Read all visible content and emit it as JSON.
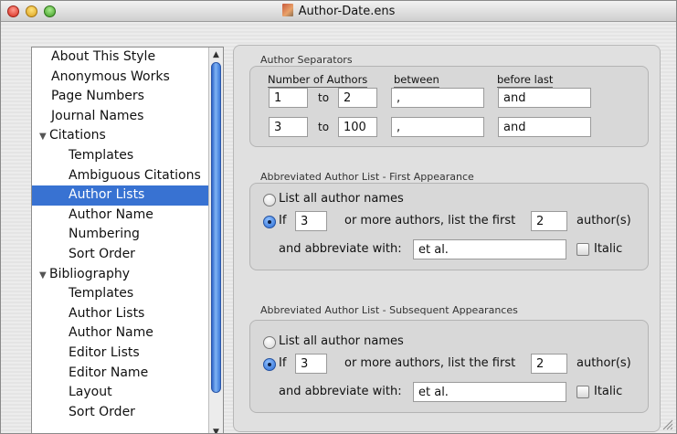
{
  "window": {
    "title": "Author-Date.ens"
  },
  "sidebar": {
    "items": [
      {
        "label": "About This Style",
        "level": 0
      },
      {
        "label": "Anonymous Works",
        "level": 0
      },
      {
        "label": "Page Numbers",
        "level": 0
      },
      {
        "label": "Journal Names",
        "level": 0
      },
      {
        "label": "Citations",
        "level": "group"
      },
      {
        "label": "Templates",
        "level": 1
      },
      {
        "label": "Ambiguous Citations",
        "level": 1
      },
      {
        "label": "Author Lists",
        "level": 1,
        "selected": true
      },
      {
        "label": "Author Name",
        "level": 1
      },
      {
        "label": "Numbering",
        "level": 1
      },
      {
        "label": "Sort Order",
        "level": 1
      },
      {
        "label": "Bibliography",
        "level": "group"
      },
      {
        "label": "Templates",
        "level": 1
      },
      {
        "label": "Author Lists",
        "level": 1
      },
      {
        "label": "Author Name",
        "level": 1
      },
      {
        "label": "Editor Lists",
        "level": 1
      },
      {
        "label": "Editor Name",
        "level": 1
      },
      {
        "label": "Layout",
        "level": 1
      },
      {
        "label": "Sort Order",
        "level": 1
      }
    ],
    "disclosure_glyph": "▼",
    "scroll_up_glyph": "▲",
    "scroll_down_glyph": "▼"
  },
  "author_separators": {
    "title": "Author Separators",
    "col_number": "Number of Authors",
    "col_between": "between",
    "col_before_last": "before last",
    "to_label": "to",
    "rows": [
      {
        "from": "1",
        "to": "2",
        "between": ",",
        "before_last": "and"
      },
      {
        "from": "3",
        "to": "100",
        "between": ",",
        "before_last": "and"
      }
    ]
  },
  "first_appearance": {
    "title": "Abbreviated Author List - First Appearance",
    "list_all_label": "List all author names",
    "list_all_selected": false,
    "if_label": "If",
    "if_selected": true,
    "if_value": "3",
    "more_label": "or more authors, list the first",
    "first_value": "2",
    "authors_suffix": "author(s)",
    "abbreviate_label": "and abbreviate with:",
    "abbreviate_value": "et al.",
    "italic_label": "Italic",
    "italic_checked": false
  },
  "subsequent_appearances": {
    "title": "Abbreviated Author List - Subsequent Appearances",
    "list_all_label": "List all author names",
    "list_all_selected": false,
    "if_label": "If",
    "if_selected": true,
    "if_value": "3",
    "more_label": "or more authors, list the first",
    "first_value": "2",
    "authors_suffix": "author(s)",
    "abbreviate_label": "and abbreviate with:",
    "abbreviate_value": "et al.",
    "italic_label": "Italic",
    "italic_checked": false
  }
}
